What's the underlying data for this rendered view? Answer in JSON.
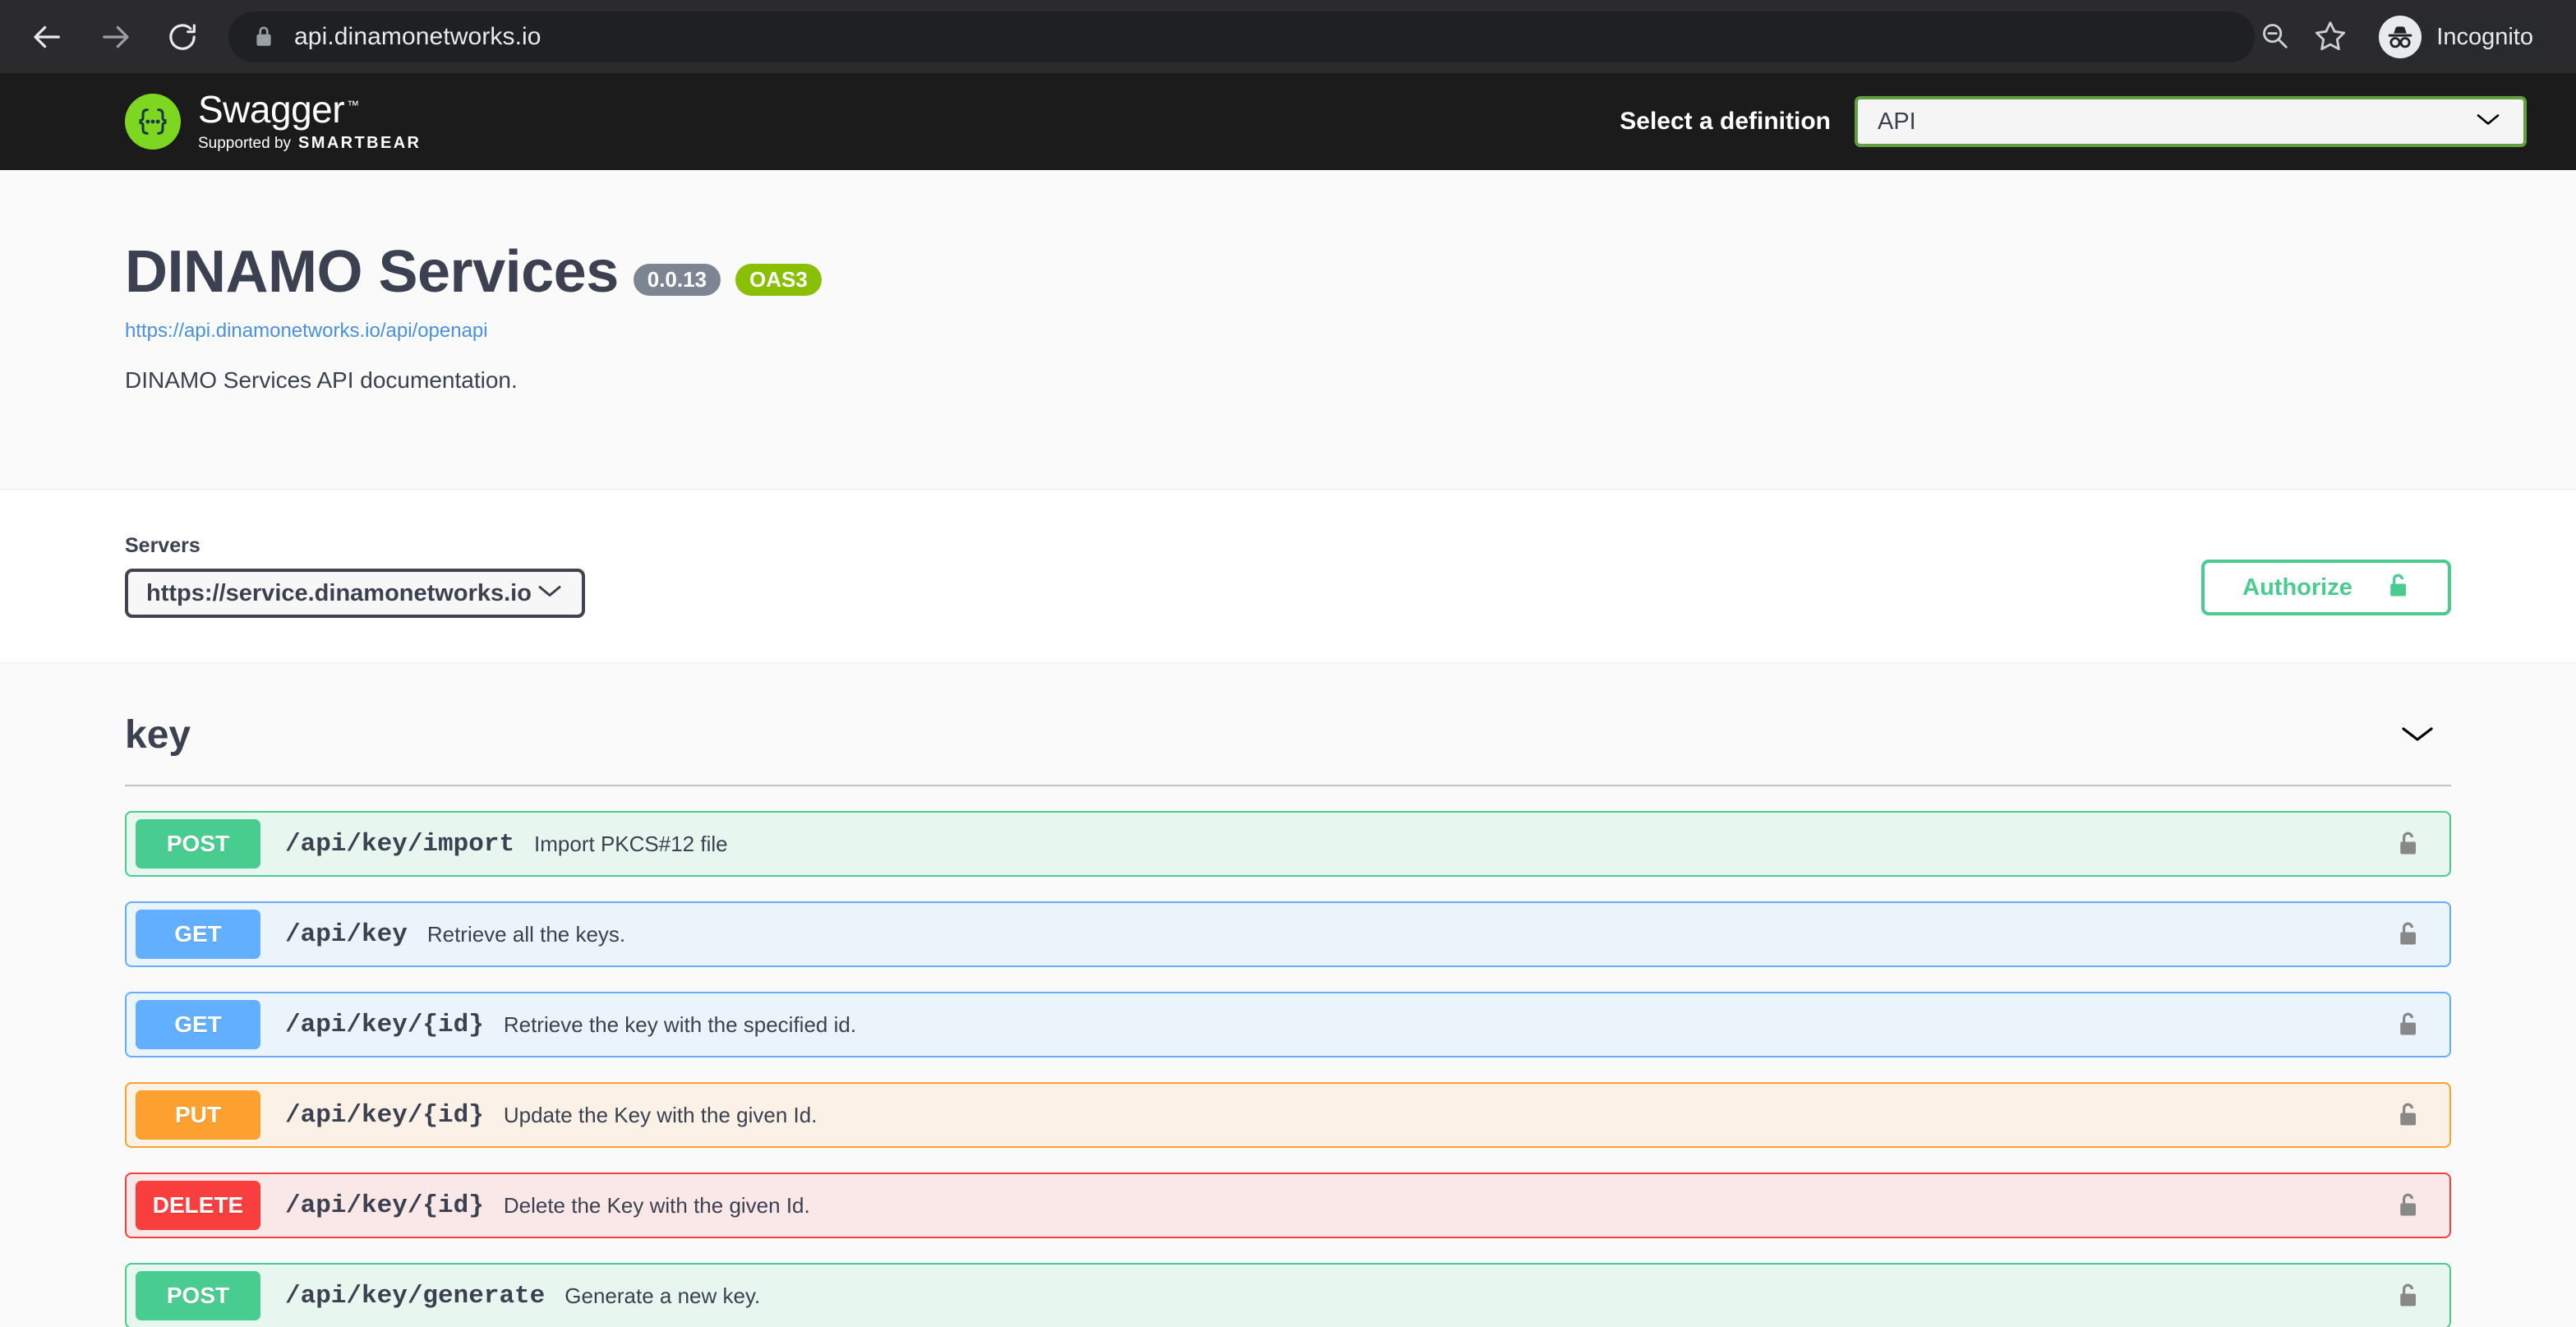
{
  "browser": {
    "back_icon": "arrow-left-icon",
    "forward_icon": "arrow-right-icon",
    "reload_icon": "reload-icon",
    "site_lock_icon": "lock-icon",
    "url": "api.dinamonetworks.io",
    "zoom_icon": "zoom-out-icon",
    "bookmark_icon": "star-icon",
    "profile_icon": "incognito-icon",
    "profile_label": "Incognito"
  },
  "topbar": {
    "logo_icon": "swagger-braces-icon",
    "logo_word": "Swagger",
    "logo_tm": "™",
    "logo_supported": "Supported by",
    "logo_brand": "SMARTBEAR",
    "definition_label": "Select a definition",
    "definition_value": "API",
    "definition_chevron_icon": "chevron-down-icon"
  },
  "info": {
    "title": "DINAMO Services",
    "version_badge": "0.0.13",
    "spec_badge": "OAS3",
    "url": "https://api.dinamonetworks.io/api/openapi",
    "description": "DINAMO Services API documentation."
  },
  "servers": {
    "label": "Servers",
    "selected": "https://service.dinamonetworks.io",
    "chevron_icon": "chevron-down-icon",
    "authorize_label": "Authorize",
    "authorize_icon": "unlock-icon"
  },
  "tag": {
    "name": "key",
    "collapse_icon": "chevron-down-icon"
  },
  "operations": [
    {
      "method": "POST",
      "method_class": "post",
      "path": "/api/key/import",
      "summary": "Import PKCS#12 file",
      "lock_icon": "unlock-icon"
    },
    {
      "method": "GET",
      "method_class": "get",
      "path": "/api/key",
      "summary": "Retrieve all the keys.",
      "lock_icon": "unlock-icon"
    },
    {
      "method": "GET",
      "method_class": "get",
      "path": "/api/key/{id}",
      "summary": "Retrieve the key with the specified id.",
      "lock_icon": "unlock-icon"
    },
    {
      "method": "PUT",
      "method_class": "put",
      "path": "/api/key/{id}",
      "summary": "Update the Key with the given Id.",
      "lock_icon": "unlock-icon"
    },
    {
      "method": "DELETE",
      "method_class": "delete",
      "path": "/api/key/{id}",
      "summary": "Delete the Key with the given Id.",
      "lock_icon": "unlock-icon"
    },
    {
      "method": "POST",
      "method_class": "post",
      "path": "/api/key/generate",
      "summary": "Generate a new key.",
      "lock_icon": "unlock-icon"
    }
  ],
  "colors": {
    "post": "#49cc90",
    "get": "#61affe",
    "put": "#fca130",
    "delete": "#f93e3e",
    "oas_badge": "#89bf04",
    "version_badge": "#7d8492",
    "link": "#4990e2",
    "text": "#3b4151"
  }
}
